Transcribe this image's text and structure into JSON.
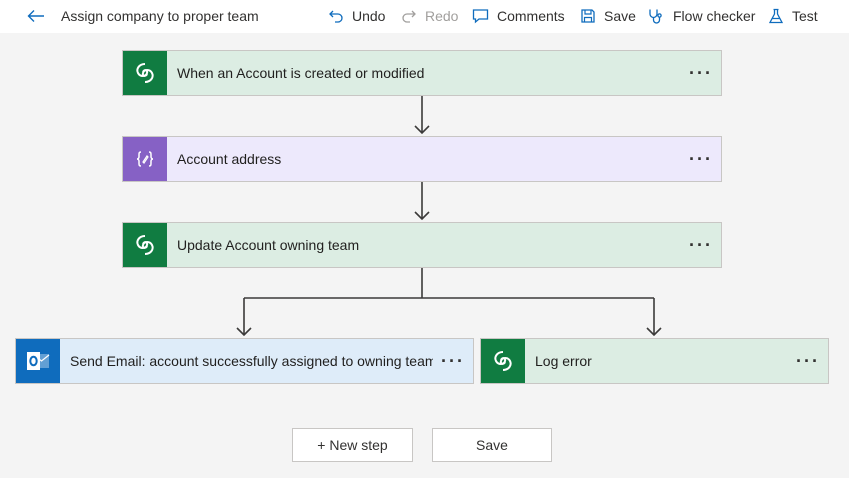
{
  "header": {
    "title": "Assign company to proper team",
    "toolbar": {
      "undo": "Undo",
      "redo": "Redo",
      "comments": "Comments",
      "save": "Save",
      "flow_checker": "Flow checker",
      "test": "Test"
    }
  },
  "steps": {
    "trigger": {
      "label": "When an Account is created or modified",
      "icon": "dataverse-icon"
    },
    "compose": {
      "label": "Account address",
      "icon": "compose-icon"
    },
    "update": {
      "label": "Update Account owning team",
      "icon": "dataverse-icon"
    },
    "send_email": {
      "label": "Send Email: account successfully assigned to owning team",
      "icon": "outlook-icon"
    },
    "log_error": {
      "label": "Log error",
      "icon": "dataverse-icon"
    }
  },
  "footer": {
    "new_step": "+ New step",
    "save": "Save"
  },
  "colors": {
    "dataverse": "#107c41",
    "compose": "#8661c5",
    "outlook": "#0f6cbd"
  }
}
